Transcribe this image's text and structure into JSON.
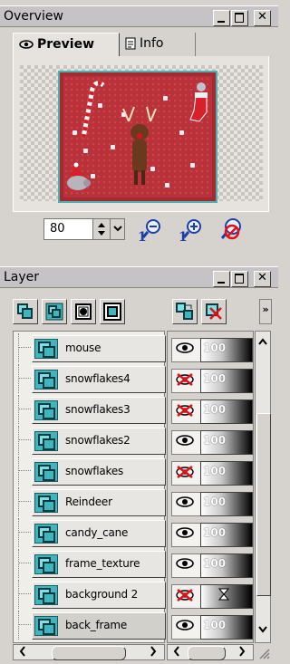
{
  "overview_panel": {
    "title": "Overview",
    "tabs": [
      {
        "label": "Preview",
        "icon": "eye-icon"
      },
      {
        "label": "Info",
        "icon": "document-icon"
      }
    ],
    "zoom_value": "80",
    "tools": [
      "zoom-out-icon",
      "zoom-in-icon",
      "zoom-reset-icon"
    ]
  },
  "layer_panel": {
    "title": "Layer",
    "toolbar": [
      "new-layer-icon",
      "new-group-icon",
      "layer-mask-icon",
      "layer-frame-icon",
      "merge-layers-icon",
      "delete-layer-icon"
    ],
    "overflow_label": "»",
    "layers": [
      {
        "name": "mouse",
        "visible": true,
        "opacity": "100"
      },
      {
        "name": "snowflakes4",
        "visible": false,
        "opacity": "100"
      },
      {
        "name": "snowflakes3",
        "visible": false,
        "opacity": "100"
      },
      {
        "name": "snowflakes2",
        "visible": true,
        "opacity": "100"
      },
      {
        "name": "snowflakes",
        "visible": false,
        "opacity": "100"
      },
      {
        "name": "Reindeer",
        "visible": true,
        "opacity": "100"
      },
      {
        "name": "candy_cane",
        "visible": true,
        "opacity": "100"
      },
      {
        "name": "frame_texture",
        "visible": true,
        "opacity": "100"
      },
      {
        "name": "background 2",
        "visible": false,
        "opacity": ""
      },
      {
        "name": "back_frame",
        "visible": true,
        "opacity": "100"
      }
    ]
  },
  "window_buttons": {
    "minimize": "_",
    "maximize": "□",
    "close": "✕"
  },
  "colors": {
    "panel": "#d6d3ce",
    "accent": "#3fb6bd",
    "canvas": "#b9323a"
  }
}
